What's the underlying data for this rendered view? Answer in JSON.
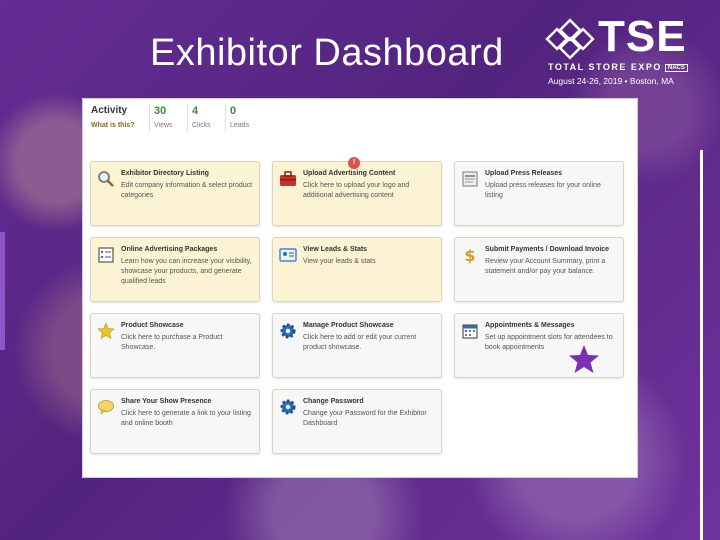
{
  "slide": {
    "title": "Exhibitor Dashboard"
  },
  "logo": {
    "word": "TSE",
    "sub": "TOTAL STORE EXPO",
    "box": "NACS",
    "date": "August 24-26, 2019 • Boston, MA"
  },
  "activity": {
    "label": "Activity",
    "link": "What is this?",
    "stats": [
      {
        "value": "30",
        "label": "Views"
      },
      {
        "value": "4",
        "label": "Clicks"
      },
      {
        "value": "0",
        "label": "Leads"
      }
    ]
  },
  "badge": "!",
  "cards": [
    {
      "title": "Exhibitor Directory Listing",
      "desc": "Edit company information & select product categories",
      "icon": "magnifier-icon"
    },
    {
      "title": "Upload Advertising Content",
      "desc": "Click here to upload your logo and additional advertising content",
      "icon": "toolbox-icon"
    },
    {
      "title": "Upload Press Releases",
      "desc": "Upload press releases for your online listing",
      "icon": "document-icon"
    },
    {
      "title": "Online Advertising Packages",
      "desc": "Learn how you can increase your visibility, showcase your products, and generate qualified leads",
      "icon": "list-icon"
    },
    {
      "title": "View Leads & Stats",
      "desc": "View your leads & stats",
      "icon": "id-card-icon"
    },
    {
      "title": "Submit Payments / Download Invoice",
      "desc": "Review your Account Summary, print a statement and/or pay your balance.",
      "icon": "dollar-icon"
    },
    {
      "title": "Product Showcase",
      "desc": "Click here to purchase a Product Showcase.",
      "icon": "star-icon"
    },
    {
      "title": "Manage Product Showcase",
      "desc": "Click here to add or edit your current product showcase.",
      "icon": "gear-icon"
    },
    {
      "title": "Appointments & Messages",
      "desc": "Set up appointment slots for attendees to book appointments",
      "icon": "calendar-icon"
    },
    {
      "title": "Share Your Show Presence",
      "desc": "Click here to generate a link to your listing and online booth",
      "icon": "speech-bubble-icon"
    },
    {
      "title": "Change Password",
      "desc": "Change your Password for the Exhibitor Dashboard",
      "icon": "gear-icon"
    }
  ],
  "colors": {
    "purple": "#5b2a86",
    "accent_star": "#7b2fb5",
    "stat_green": "#3c8c3c"
  }
}
